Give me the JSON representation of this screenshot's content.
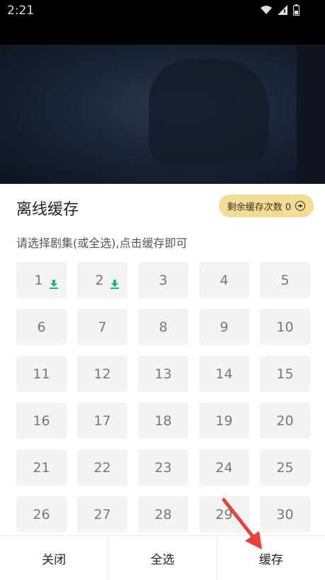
{
  "status": {
    "time": "2:21"
  },
  "sheet": {
    "title": "离线缓存",
    "remaining_label": "剩余缓存次数 0",
    "instruction": "请选择剧集(或全选),点击缓存即可"
  },
  "episodes": [
    {
      "n": "1",
      "downloaded": true
    },
    {
      "n": "2",
      "downloaded": true
    },
    {
      "n": "3"
    },
    {
      "n": "4"
    },
    {
      "n": "5"
    },
    {
      "n": "6"
    },
    {
      "n": "7"
    },
    {
      "n": "8"
    },
    {
      "n": "9"
    },
    {
      "n": "10"
    },
    {
      "n": "11"
    },
    {
      "n": "12"
    },
    {
      "n": "13"
    },
    {
      "n": "14"
    },
    {
      "n": "15"
    },
    {
      "n": "16"
    },
    {
      "n": "17"
    },
    {
      "n": "18"
    },
    {
      "n": "19"
    },
    {
      "n": "20"
    },
    {
      "n": "21"
    },
    {
      "n": "22"
    },
    {
      "n": "23"
    },
    {
      "n": "24"
    },
    {
      "n": "25"
    },
    {
      "n": "26"
    },
    {
      "n": "27"
    },
    {
      "n": "28"
    },
    {
      "n": "29"
    },
    {
      "n": "30"
    }
  ],
  "bottom": {
    "close": "关闭",
    "select_all": "全选",
    "cache": "缓存"
  },
  "colors": {
    "badge": "#f3dc95",
    "download_icon": "#18b88a",
    "annotation_arrow": "#e8413a"
  }
}
